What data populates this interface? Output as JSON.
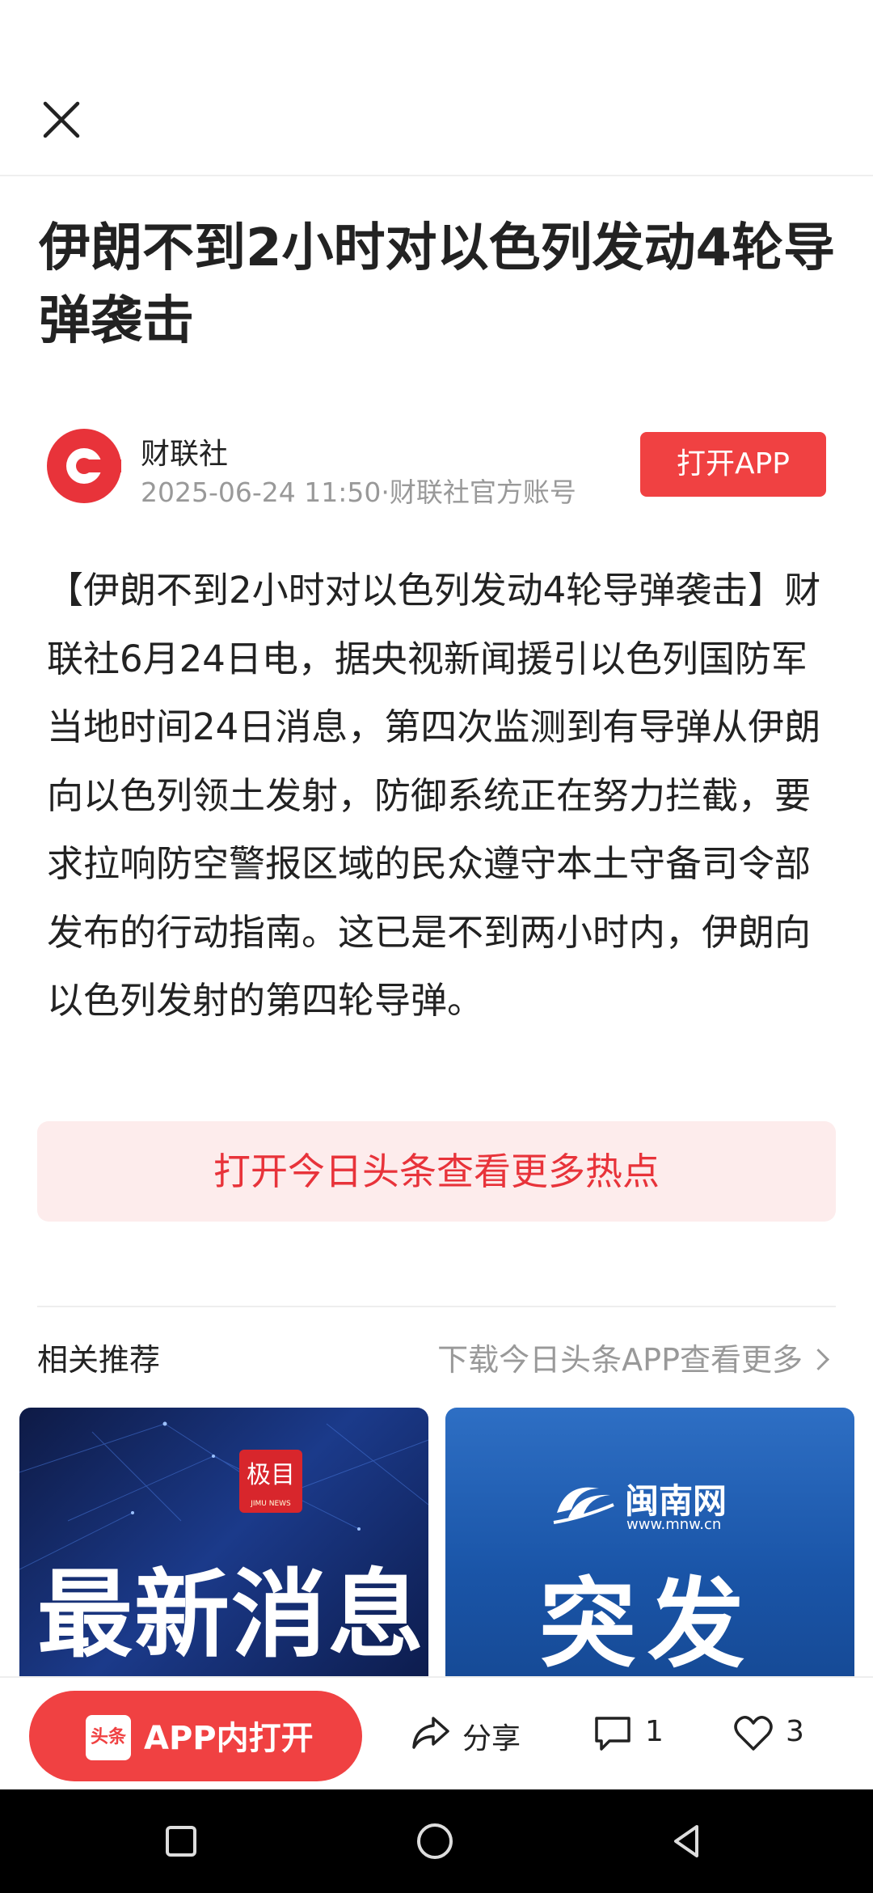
{
  "article": {
    "title": "伊朗不到2小时对以色列发动4轮导弹袭击",
    "author": "财联社",
    "meta": "2025-06-24 11:50·财联社官方账号",
    "open_app_label": "打开APP",
    "body": "【伊朗不到2小时对以色列发动4轮导弹袭击】财联社6月24日电，据央视新闻援引以色列国防军当地时间24日消息，第四次监测到有导弹从伊朗向以色列领土发射，防御系统正在努力拦截，要求拉响防空警报区域的民众遵守本土守备司令部发布的行动指南。这已是不到两小时内，伊朗向以色列发射的第四轮导弹。",
    "hot_button_label": "打开今日头条查看更多热点"
  },
  "related": {
    "title": "相关推荐",
    "more_label": "下载今日头条APP查看更多",
    "cards": [
      {
        "badge": "极目",
        "badge_sub": "JIMU NEWS",
        "headline": "最新消息"
      },
      {
        "brand": "闽南网",
        "url": "www.mnw.cn",
        "headline": "突发"
      }
    ]
  },
  "bottom_bar": {
    "app_icon_text": "头条",
    "app_open_label": "APP内打开",
    "share_label": "分享",
    "comment_count": "1",
    "like_count": "3"
  },
  "icons": {
    "close": "close-icon",
    "share": "share-icon",
    "comment": "comment-icon",
    "like": "heart-icon",
    "nav_recent": "square-icon",
    "nav_home": "circle-icon",
    "nav_back": "triangle-back-icon"
  },
  "colors": {
    "accent": "#f04142",
    "hot_bg": "#fdecec"
  }
}
